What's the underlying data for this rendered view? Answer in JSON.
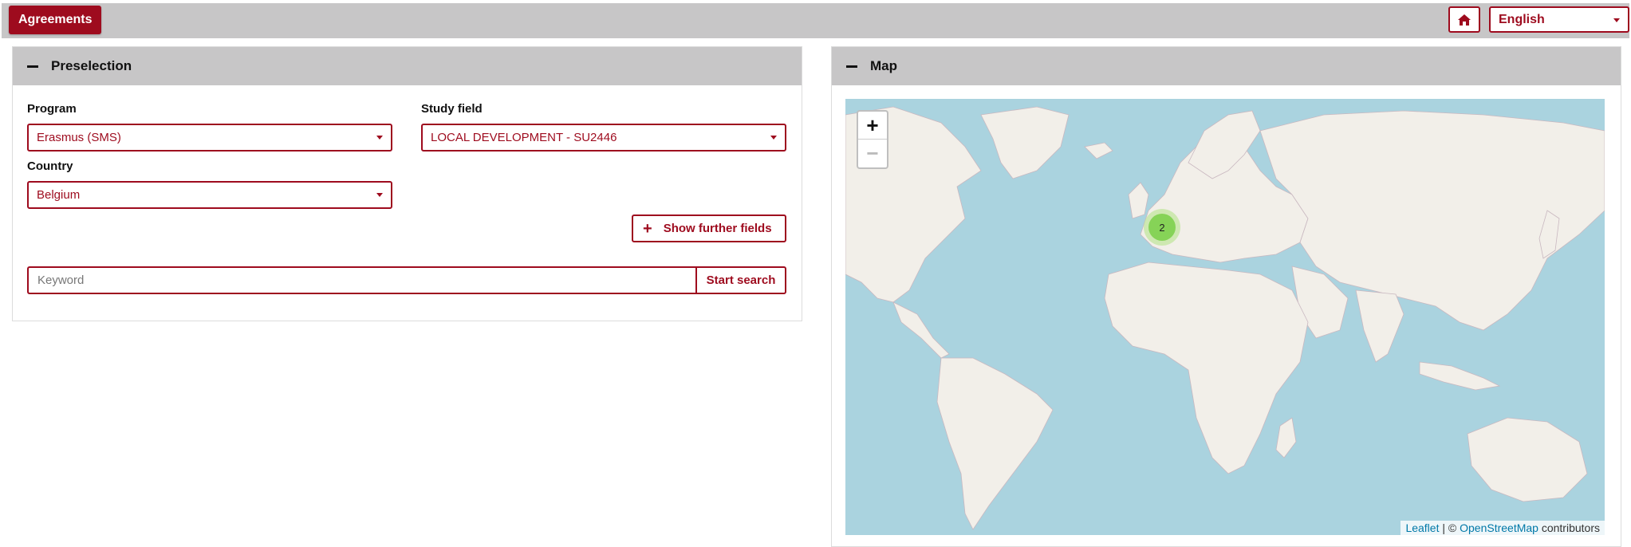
{
  "topbar": {
    "agreements_label": "Agreements",
    "language": "English",
    "home_icon": "home-icon"
  },
  "preselection": {
    "title": "Preselection",
    "program_label": "Program",
    "program_value": "Erasmus (SMS)",
    "study_field_label": "Study field",
    "study_field_value": "LOCAL DEVELOPMENT - SU2446",
    "country_label": "Country",
    "country_value": "Belgium",
    "further_fields_label": "Show further fields",
    "keyword_placeholder": "Keyword",
    "search_label": "Start search"
  },
  "map": {
    "title": "Map",
    "zoom_in": "+",
    "zoom_out": "−",
    "cluster_count": "2",
    "attribution_leaflet": "Leaflet",
    "attribution_sep": "| ©",
    "attribution_osm": "OpenStreetMap",
    "attribution_suffix": "contributors"
  },
  "colors": {
    "accent": "#9e0b1e",
    "header_bg": "#c7c6c7",
    "water": "#aad3df",
    "land": "#f2efe9"
  }
}
